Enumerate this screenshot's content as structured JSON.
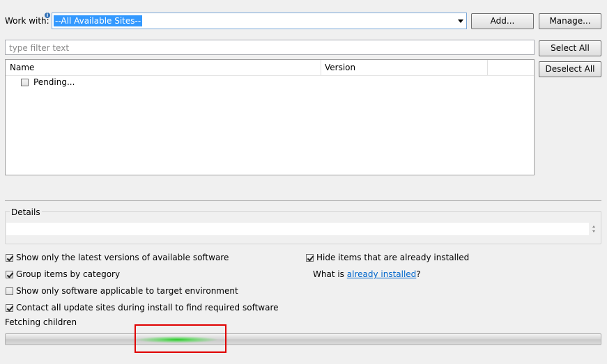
{
  "work_with": {
    "label": "Work with:",
    "info_icon": "info-icon",
    "selected_site": "--All Available Sites--",
    "add_label": "Add...",
    "manage_label": "Manage..."
  },
  "filter": {
    "placeholder": "type filter text",
    "value": ""
  },
  "buttons": {
    "select_all": "Select All",
    "deselect_all": "Deselect All"
  },
  "table": {
    "columns": [
      "Name",
      "Version"
    ],
    "rows": [
      {
        "name": "Pending...",
        "version": "",
        "checked": false
      }
    ]
  },
  "details": {
    "label": "Details",
    "text": ""
  },
  "options": {
    "latest_versions": {
      "label": "Show only the latest versions of available software",
      "checked": true
    },
    "group_by_category": {
      "label": "Group items by category",
      "checked": true
    },
    "applicable_target": {
      "label": "Show only software applicable to target environment",
      "checked": false
    },
    "contact_sites": {
      "label": "Contact all update sites during install to find required software",
      "checked": true
    },
    "hide_installed": {
      "label": "Hide items that are already installed",
      "checked": true
    },
    "what_is_prefix": "What is ",
    "already_installed_link": "already installed",
    "what_is_suffix": "?"
  },
  "status": {
    "text": "Fetching children",
    "progress": "indeterminate"
  },
  "colors": {
    "selection": "#3399ff",
    "link": "#0066cc",
    "progress_glow": "#22cc22",
    "highlight_box": "#e00000"
  }
}
